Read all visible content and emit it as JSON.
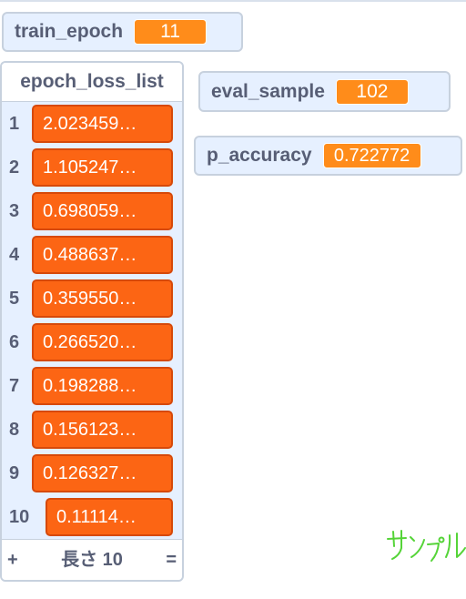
{
  "monitors": {
    "train_epoch": {
      "name": "train_epoch",
      "value": "11"
    },
    "eval_sample": {
      "name": "eval_sample",
      "value": "102"
    },
    "p_accuracy": {
      "name": "p_accuracy",
      "value": "0.722772"
    }
  },
  "list": {
    "title": "epoch_loss_list",
    "items": [
      {
        "index": "1",
        "value": "2.023459…"
      },
      {
        "index": "2",
        "value": "1.105247…"
      },
      {
        "index": "3",
        "value": "0.698059…"
      },
      {
        "index": "4",
        "value": "0.488637…"
      },
      {
        "index": "5",
        "value": "0.359550…"
      },
      {
        "index": "6",
        "value": "0.266520…"
      },
      {
        "index": "7",
        "value": "0.198288…"
      },
      {
        "index": "8",
        "value": "0.156123…"
      },
      {
        "index": "9",
        "value": "0.126327…"
      },
      {
        "index": "10",
        "value": "0.11114…"
      }
    ],
    "footer": {
      "add_label": "+",
      "length_label": "長さ 10",
      "resize_label": "="
    }
  },
  "watermark": {
    "text": "サンプル",
    "color": "#55d438"
  },
  "colors": {
    "monitor_bg": "#e6f0ff",
    "monitor_border": "#c7d1de",
    "variable_orange": "#ff8c1a",
    "list_item_orange": "#fc6514",
    "label_text": "#575e75"
  }
}
